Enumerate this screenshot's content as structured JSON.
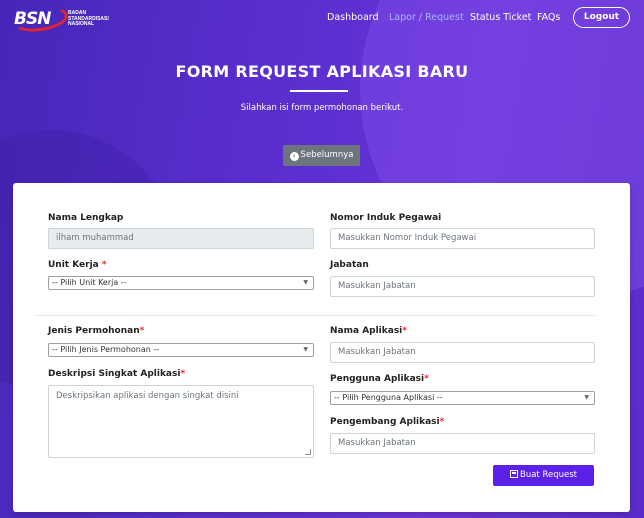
{
  "brand": {
    "logo_mark": "BSN",
    "logo_text": "Badan Standardisasi Nasional"
  },
  "nav": {
    "dashboard": "Dashboard",
    "lapor": "Lapor / Request",
    "status": "Status Ticket",
    "faqs": "FAQs",
    "logout": "Logout"
  },
  "page": {
    "title": "FORM REQUEST APLIKASI BARU",
    "subtitle": "Silahkan isi form permohonan berikut.",
    "back_button": "Sebelumnya"
  },
  "form": {
    "nama_lengkap": {
      "label": "Nama Lengkap",
      "value": "ilham muhammad"
    },
    "nip": {
      "label": "Nomor Induk Pegawai",
      "placeholder": "Masukkan Nomor Induk Pegawai"
    },
    "unit_kerja": {
      "label": "Unit Kerja",
      "required": "*",
      "selected": "-- Pilih Unit Kerja --"
    },
    "jabatan": {
      "label": "Jabatan",
      "placeholder": "Masukkan Jabatan"
    },
    "jenis_permohonan": {
      "label": "Jenis Permohonan",
      "required": "*",
      "selected": "-- Pilih Jenis Permohonan --"
    },
    "nama_aplikasi": {
      "label": "Nama Aplikasi",
      "required": "*",
      "placeholder": "Masukkan Jabatan"
    },
    "deskripsi": {
      "label": "Deskripsi Singkat Aplikasi",
      "required": "*",
      "placeholder": "Deskripsikan aplikasi dengan singkat disini"
    },
    "pengguna": {
      "label": "Pengguna Aplikasi",
      "required": "*",
      "selected": "-- Pilih Pengguna Aplikasi --"
    },
    "pengembang": {
      "label": "Pengembang Aplikasi",
      "required": "*",
      "placeholder": "Masukkan Jabatan"
    },
    "submit": "Buat Request"
  },
  "colors": {
    "hero": "#5b2fc9",
    "primary_button": "#5b21e6",
    "secondary_button": "#6c757d",
    "required": "#e0262b",
    "nav_active": "#aab4ff"
  },
  "icons": {
    "back": "arrow-left-circle-icon",
    "submit": "save-icon",
    "select_caret": "chevron-down-icon"
  }
}
